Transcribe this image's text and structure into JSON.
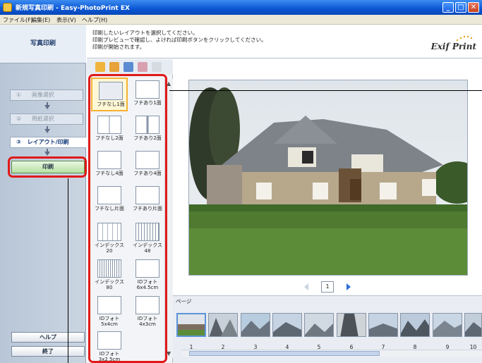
{
  "window": {
    "title": "新規写真印刷 - Easy-PhotoPrint EX",
    "minimize": "_",
    "maximize": "□",
    "close": "✕"
  },
  "menu": [
    "ファイル(F)",
    "編集(E)",
    "表示(V)",
    "ヘルプ(H)"
  ],
  "sidebar": {
    "header": "写真印刷",
    "steps": [
      {
        "num": "①",
        "label": "画像選択"
      },
      {
        "num": "②",
        "label": "用紙選択"
      },
      {
        "num": "③",
        "label": "レイアウト/印刷"
      }
    ],
    "print_button": "印刷",
    "help_button": "ヘルプ",
    "exit_button": "終了"
  },
  "instructions": {
    "line1": "印刷したいレイアウトを選択してください。",
    "line2": "印刷プレビューで確認し、よければ印刷ボタンをクリックしてください。",
    "line3": "印刷が開始されます。",
    "logo": "Exif Print"
  },
  "toolbar": {
    "icons": [
      "rotate-left-icon",
      "rotate-right-icon",
      "crop-icon",
      "date-icon",
      "clear-icon"
    ]
  },
  "layouts": [
    {
      "label": "フチなし1面",
      "selected": true
    },
    {
      "label": "フチあり1面"
    },
    {
      "label": "フチなし2面"
    },
    {
      "label": "フチあり2面"
    },
    {
      "label": "フチなし4面"
    },
    {
      "label": "フチあり4面"
    },
    {
      "label": "フチなし片面"
    },
    {
      "label": "フチあり片面"
    },
    {
      "label": "インデックス 20"
    },
    {
      "label": "インデックス 48"
    },
    {
      "label": "インデックス 80"
    },
    {
      "label": "IDフォト 6x4.5cm"
    },
    {
      "label": "IDフォト 5x4cm"
    },
    {
      "label": "IDフォト 4x3cm"
    },
    {
      "label": "IDフォト 3x2.5cm"
    }
  ],
  "pager": {
    "current": "1"
  },
  "pages": {
    "label": "ページ",
    "numbers": [
      "1",
      "2",
      "3",
      "4",
      "5",
      "6",
      "7",
      "8",
      "9",
      "10"
    ]
  },
  "colors": {
    "titlebar": "#0a56d4",
    "highlight": "#e01a1a",
    "print_button": "#b6e0a2",
    "selection": "#f4b233"
  }
}
